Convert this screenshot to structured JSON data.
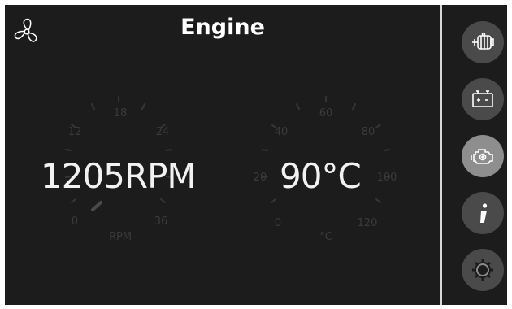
{
  "header": {
    "title": "Engine"
  },
  "icons": {
    "fan": "fan-icon",
    "alternator": "alternator-icon",
    "battery": "battery-icon",
    "engine": "engine-icon",
    "info": "info-icon",
    "settings": "gear-icon"
  },
  "gauges": {
    "rpm": {
      "reading": "1205RPM",
      "unit_label": "RPM",
      "ticks": [
        "0",
        "12",
        "18",
        "24",
        "36"
      ]
    },
    "temp": {
      "reading": "90°C",
      "unit_label": "°C",
      "ticks": [
        "0",
        "20",
        "40",
        "60",
        "80",
        "100",
        "120"
      ]
    }
  },
  "sidebar": {
    "items": [
      {
        "name": "alternator",
        "active": false
      },
      {
        "name": "battery",
        "active": false
      },
      {
        "name": "engine",
        "active": true
      },
      {
        "name": "info",
        "active": false
      },
      {
        "name": "settings",
        "active": false
      }
    ]
  },
  "colors": {
    "background": "#1c1c1c",
    "text": "#f2f2f2",
    "button": "#4a4a4a",
    "button_active": "#8e8e8e",
    "gauge_dim": "#3a3a3a"
  }
}
